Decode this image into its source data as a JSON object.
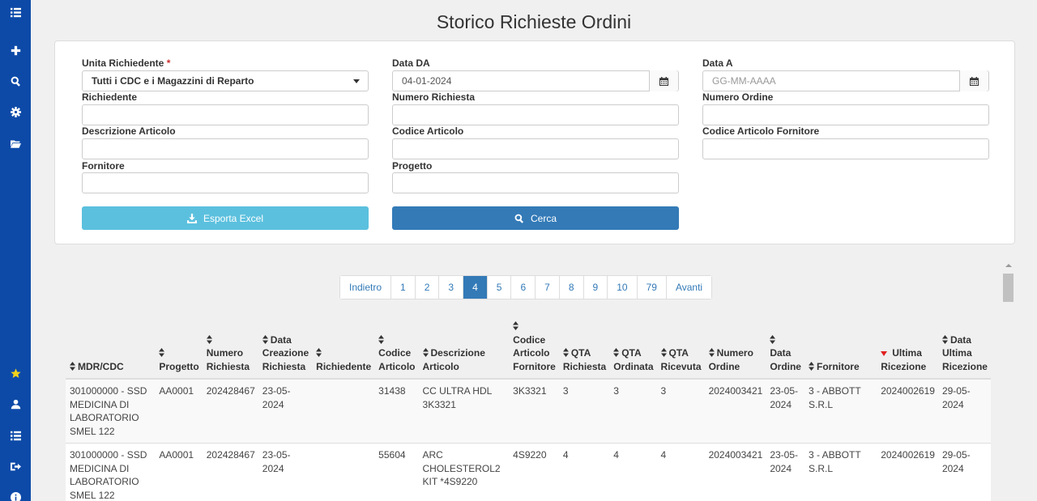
{
  "page": {
    "title": "Storico Richieste Ordini"
  },
  "sidebar": {
    "top_icons": [
      "list-icon",
      "plus-icon",
      "search-icon",
      "gear-icon",
      "folder-open-icon"
    ],
    "bottom_icons": [
      "star-icon",
      "user-icon",
      "list-icon",
      "sign-out-icon",
      "info-icon"
    ]
  },
  "form": {
    "unita_label": "Unita Richiedente",
    "unita_required": "*",
    "unita_value": "Tutti i CDC e i Magazzini di Reparto",
    "data_da_label": "Data DA",
    "data_da_value": "04-01-2024",
    "data_a_label": "Data A",
    "data_a_placeholder": "GG-MM-AAAA",
    "richiedente_label": "Richiedente",
    "numero_richiesta_label": "Numero Richiesta",
    "numero_ordine_label": "Numero Ordine",
    "descrizione_label": "Descrizione Articolo",
    "codice_label": "Codice Articolo",
    "codice_fornitore_label": "Codice Articolo Fornitore",
    "fornitore_label": "Fornitore",
    "progetto_label": "Progetto",
    "export_label": "Esporta Excel",
    "search_label": "Cerca"
  },
  "pagination": {
    "prev": "Indietro",
    "pages": [
      "1",
      "2",
      "3",
      "4",
      "5",
      "6",
      "7",
      "8",
      "9",
      "10",
      "79"
    ],
    "active": "4",
    "next": "Avanti"
  },
  "table": {
    "headers": [
      [
        "MDR/CDC"
      ],
      [
        "Progetto"
      ],
      [
        "Numero",
        "Richiesta"
      ],
      [
        "Data",
        "Creazione",
        "Richiesta"
      ],
      [
        "Richiedente"
      ],
      [
        "Codice",
        "Articolo"
      ],
      [
        "Descrizione",
        "Articolo"
      ],
      [
        "Codice",
        "Articolo",
        "Fornitore"
      ],
      [
        "QTA",
        "Richiesta"
      ],
      [
        "QTA",
        "Ordinata"
      ],
      [
        "QTA",
        "Ricevuta"
      ],
      [
        "Numero",
        "Ordine"
      ],
      [
        "Data",
        "Ordine"
      ],
      [
        "Fornitore"
      ],
      [
        "Ultima",
        "Ricezione"
      ],
      [
        "Data",
        "Ultima",
        "Ricezione"
      ]
    ],
    "rows": [
      [
        "301000000 - SSD MEDICINA DI LABORATORIO SMEL 122",
        "AA0001",
        "202428467",
        "23-05-2024",
        "",
        "31438",
        "CC ULTRA HDL 3K3321",
        "3K3321",
        "3",
        "3",
        "3",
        "2024003421",
        "23-05-2024",
        "3 - ABBOTT S.R.L",
        "2024002619",
        "29-05-2024"
      ],
      [
        "301000000 - SSD MEDICINA DI LABORATORIO SMEL 122",
        "AA0001",
        "202428467",
        "23-05-2024",
        "",
        "55604",
        "ARC CHOLESTEROL2 KIT *4S9220",
        "4S9220",
        "4",
        "4",
        "4",
        "2024003421",
        "23-05-2024",
        "3 - ABBOTT S.R.L",
        "2024002619",
        "29-05-2024"
      ]
    ]
  }
}
